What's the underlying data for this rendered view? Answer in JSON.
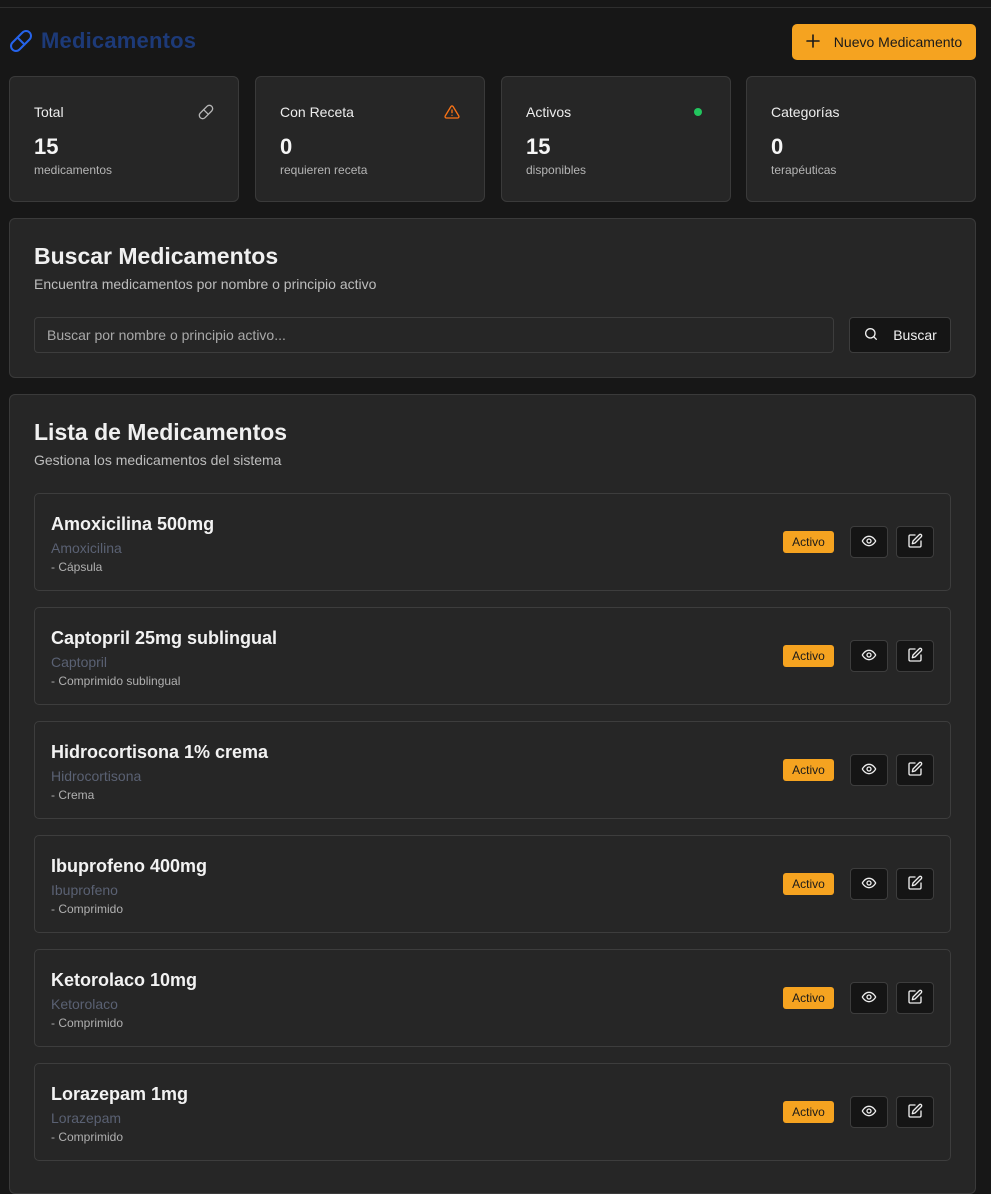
{
  "header": {
    "title": "Medicamentos",
    "new_button_label": "Nuevo Medicamento"
  },
  "stats": [
    {
      "label": "Total",
      "value": "15",
      "sub": "medicamentos",
      "icon": "pill-icon"
    },
    {
      "label": "Con Receta",
      "value": "0",
      "sub": "requieren receta",
      "icon": "warning-icon"
    },
    {
      "label": "Activos",
      "value": "15",
      "sub": "disponibles",
      "icon": "green-dot-icon"
    },
    {
      "label": "Categorías",
      "value": "0",
      "sub": "terapéuticas",
      "icon": ""
    }
  ],
  "search": {
    "title": "Buscar Medicamentos",
    "description": "Encuentra medicamentos por nombre o principio activo",
    "placeholder": "Buscar por nombre o principio activo...",
    "button_label": "Buscar"
  },
  "list": {
    "title": "Lista de Medicamentos",
    "description": "Gestiona los medicamentos del sistema",
    "items": [
      {
        "name": "Amoxicilina 500mg",
        "principle": "Amoxicilina",
        "form": "- Cápsula",
        "status": "Activo"
      },
      {
        "name": "Captopril 25mg sublingual",
        "principle": "Captopril",
        "form": "- Comprimido sublingual",
        "status": "Activo"
      },
      {
        "name": "Hidrocortisona 1% crema",
        "principle": "Hidrocortisona",
        "form": "- Crema",
        "status": "Activo"
      },
      {
        "name": "Ibuprofeno 400mg",
        "principle": "Ibuprofeno",
        "form": "- Comprimido",
        "status": "Activo"
      },
      {
        "name": "Ketorolaco 10mg",
        "principle": "Ketorolaco",
        "form": "- Comprimido",
        "status": "Activo"
      },
      {
        "name": "Lorazepam 1mg",
        "principle": "Lorazepam",
        "form": "- Comprimido",
        "status": "Activo"
      }
    ]
  },
  "colors": {
    "accent": "#f5a320",
    "title": "#1d3a78",
    "warning": "#f97316",
    "success": "#22c55e",
    "background": "#171717",
    "card": "#262626"
  }
}
